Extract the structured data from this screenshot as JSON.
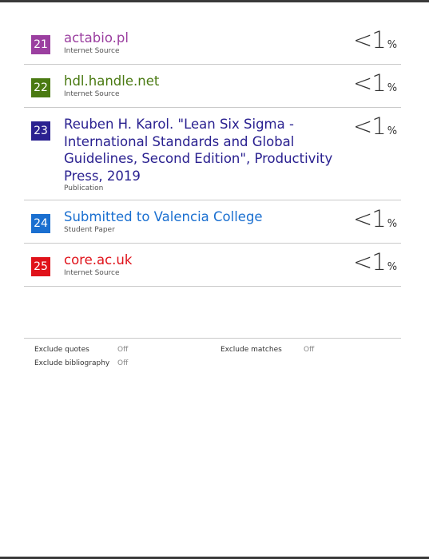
{
  "sources": [
    {
      "rank": "21",
      "title": "actabio.pl",
      "type": "Internet Source",
      "percent": "<1",
      "percent_sign": "%",
      "color": "#9b3fa0"
    },
    {
      "rank": "22",
      "title": "hdl.handle.net",
      "type": "Internet Source",
      "percent": "<1",
      "percent_sign": "%",
      "color": "#4a7a12"
    },
    {
      "rank": "23",
      "title": "Reuben H. Karol. \"Lean Six Sigma - International Standards and Global Guidelines, Second Edition\", Productivity Press, 2019",
      "type": "Publication",
      "percent": "<1",
      "percent_sign": "%",
      "color": "#2a2190"
    },
    {
      "rank": "24",
      "title": "Submitted to Valencia College",
      "type": "Student Paper",
      "percent": "<1",
      "percent_sign": "%",
      "color": "#1a6fd0"
    },
    {
      "rank": "25",
      "title": "core.ac.uk",
      "type": "Internet Source",
      "percent": "<1",
      "percent_sign": "%",
      "color": "#e0121a"
    }
  ],
  "settings": {
    "exclude_quotes_label": "Exclude quotes",
    "exclude_quotes_value": "Off",
    "exclude_bibliography_label": "Exclude bibliography",
    "exclude_bibliography_value": "Off",
    "exclude_matches_label": "Exclude matches",
    "exclude_matches_value": "Off"
  }
}
